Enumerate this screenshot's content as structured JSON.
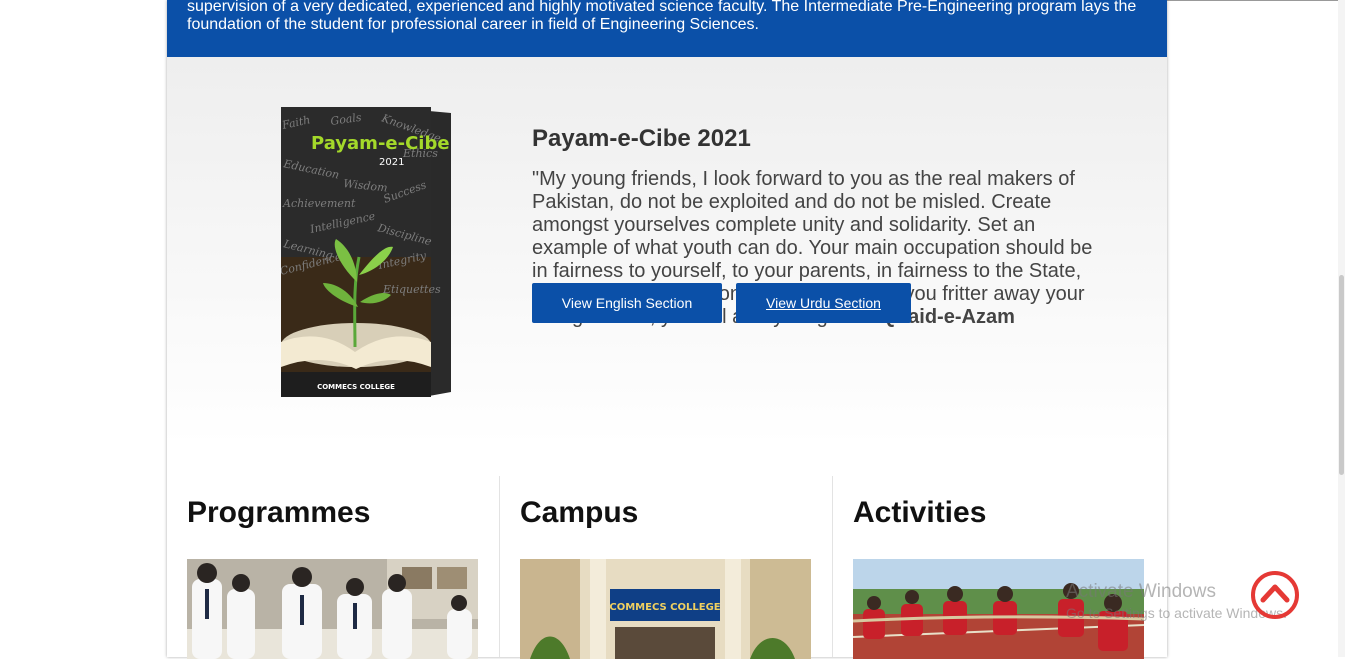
{
  "banner": {
    "text": "supervision of a very dedicated, experienced and highly motivated science faculty. The Intermediate Pre-Engineering program lays the foundation of the student for professional career in field of Engineering Sciences."
  },
  "promo": {
    "title": "Payam-e-Cibe 2021",
    "quote": "\"My young friends, I look forward to you as the real makers of Pakistan, do not be exploited and do not be misled. Create amongst yourselves complete unity and solidarity. Set an example of what youth can do. Your main occupation should be in fairness to yourself, to your parents, in fairness to the State, to devote your attention to your studies. If you fritter away your energies now, you will always regret\" –",
    "author": "Quaid-e-Azam",
    "english_button": "View English Section",
    "urdu_button": "View Urdu Section",
    "book": {
      "title": "Payam-e-Cibe",
      "year": "2021",
      "publisher": "COMMECS COLLEGE",
      "words": [
        "Faith",
        "Goals",
        "Knowledge",
        "Education",
        "Ethics",
        "Wisdom",
        "Achievement",
        "Success",
        "Intelligence",
        "Discipline",
        "Learning",
        "Integrity",
        "Confidence",
        "Etiquettes"
      ]
    }
  },
  "sections": [
    {
      "title": "Programmes"
    },
    {
      "title": "Campus",
      "sign": "COMMECS COLLEGE"
    },
    {
      "title": "Activities"
    }
  ],
  "watermark": {
    "line1": "Activate Windows",
    "line2": "Go to Settings to activate Windows."
  },
  "icons": {
    "scroll_top": "chevron-up-circle-icon"
  },
  "colors": {
    "brand_blue": "#0b50a8",
    "scroll_top_red": "#e53935"
  }
}
